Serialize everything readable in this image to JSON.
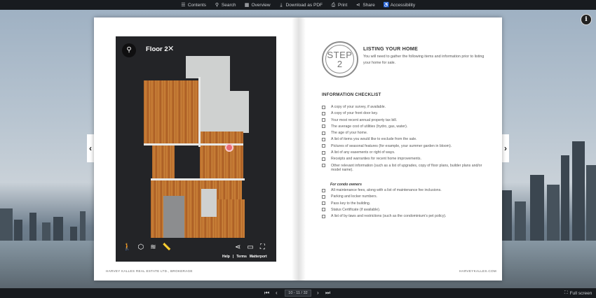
{
  "toolbar": {
    "items": [
      {
        "label": "Contents",
        "icon": "list-icon"
      },
      {
        "label": "Search",
        "icon": "search-icon"
      },
      {
        "label": "Overview",
        "icon": "grid-icon"
      },
      {
        "label": "Download as PDF",
        "icon": "download-icon"
      },
      {
        "label": "Print",
        "icon": "print-icon"
      },
      {
        "label": "Share",
        "icon": "share-icon"
      },
      {
        "label": "Accessibility",
        "icon": "accessibility-icon"
      }
    ]
  },
  "floorplan": {
    "title": "Floor 2",
    "help": "Help",
    "separator": "|",
    "terms": "Terms",
    "brand": "Matterport"
  },
  "page_left": {
    "footer": "HARVEY KALLES REAL ESTATE LTD., BROKERAGE"
  },
  "page_right": {
    "step_word": "STEP",
    "step_number": "2",
    "heading": "LISTING YOUR HOME",
    "intro": "You will need to gather the following items and information prior to listing your home for sale.",
    "checklist_title": "INFORMATION CHECKLIST",
    "checklist": [
      "A copy of your survey, if available.",
      "A copy of your front door key.",
      "Your most recent annual property tax bill.",
      "The average cost of utilities (hydro, gas, water).",
      "The age of your home.",
      "A list of items you would like to exclude from the sale.",
      "Pictures of seasonal features (for example, your summer garden in bloom).",
      "A list of any easements or right of ways.",
      "Receipts and warranties for recent home improvements.",
      "Other relevant information (such as a list of upgrades, copy of floor plans, builder plans and/or model name)."
    ],
    "condo_title": "For condo owners",
    "condo_checklist": [
      "All maintenance fees, along with a list of maintenance fee inclusions.",
      "Parking and locker numbers.",
      "Pass key to the building.",
      "Status Certificate (if available).",
      "A list of by-laws and restrictions (such as the condominium's pet policy)."
    ],
    "footer": "HARVEYKALLES.COM"
  },
  "pagination": {
    "page_field": "10 - 11 / 32",
    "fullscreen_label": "Full screen"
  },
  "colors": {
    "toolbar_bg": "#181b1f",
    "floorplan_bg": "#232427",
    "pin": "#e86a75"
  }
}
